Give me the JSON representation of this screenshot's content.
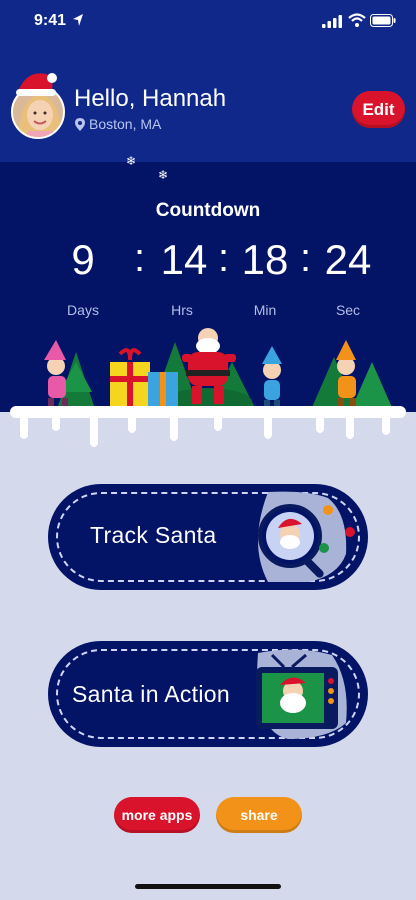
{
  "status_bar": {
    "time": "9:41"
  },
  "header": {
    "greeting": "Hello, Hannah",
    "location": "Boston, MA",
    "edit_label": "Edit"
  },
  "countdown": {
    "title": "Countdown",
    "days": "9",
    "hours": "14",
    "minutes": "18",
    "seconds": "24",
    "separator": ":",
    "units": {
      "days": "Days",
      "hours": "Hrs",
      "minutes": "Min",
      "seconds": "Sec"
    }
  },
  "actions": {
    "track_santa": "Track Santa",
    "santa_in_action": "Santa in Action"
  },
  "footer": {
    "more_apps": "more apps",
    "share": "share"
  },
  "colors": {
    "header_bg": "#10288a",
    "countdown_bg": "#031466",
    "page_bg": "#d5d9ec",
    "edit_red": "#d9132b",
    "share_orange": "#f29218"
  },
  "icons": [
    "location-arrow-icon",
    "signal-icon",
    "wifi-icon",
    "battery-icon",
    "map-pin-icon",
    "santa-hat-icon",
    "magnifier-icon",
    "tv-icon"
  ]
}
